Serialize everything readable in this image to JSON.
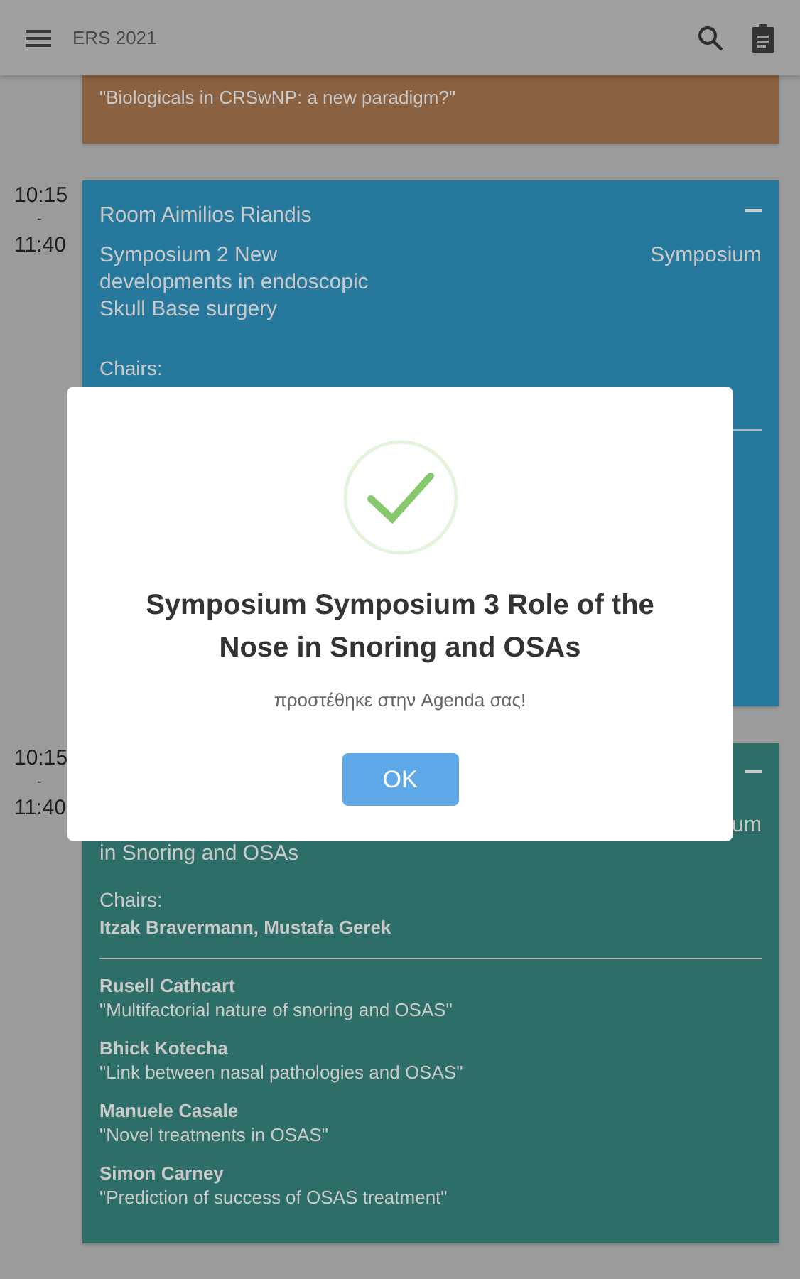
{
  "app_bar": {
    "title": "ERS 2021"
  },
  "sessions": [
    {
      "color": "#8b6241",
      "talks": [
        {
          "title": "\"Biologicals in CRSwNP: a new paradigm?\""
        }
      ]
    },
    {
      "color": "#26799c",
      "start": "10:15",
      "sep": "-",
      "end": "11:40",
      "room": "Room Aimilios Riandis",
      "title": "Symposium 2 New developments in endoscopic Skull Base surgery",
      "type": "Symposium",
      "chairs_label": "Chairs:"
    },
    {
      "color": "#2e6e68",
      "start": "10:15",
      "sep": "-",
      "end": "11:40",
      "title": "in Snoring and OSAs",
      "type": "um",
      "chairs_label": "Chairs:",
      "chairs": "Itzak Bravermann, Mustafa Gerek",
      "talks": [
        {
          "speaker": "Rusell Cathcart",
          "title": "\"Multifactorial nature of snoring and OSAS\""
        },
        {
          "speaker": "Bhick Kotecha",
          "title": "\"Link between nasal pathologies and OSAS\""
        },
        {
          "speaker": "Manuele Casale",
          "title": "\"Novel treatments in OSAS\""
        },
        {
          "speaker": "Simon Carney",
          "title": "\"Prediction of success of OSAS treatment\""
        }
      ]
    }
  ],
  "dialog": {
    "title": "Symposium Symposium 3 Role of the Nose in Snoring and OSAs",
    "message": "προστέθηκε στην Agenda σας!",
    "button": "OK"
  }
}
